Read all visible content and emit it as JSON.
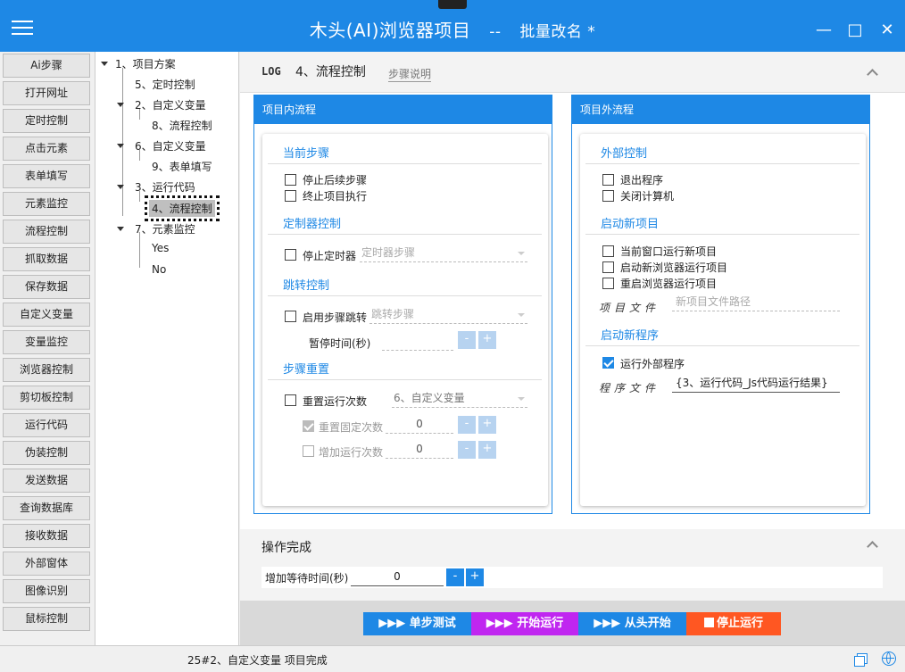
{
  "titlebar": {
    "title": "木头(AI)浏览器项目",
    "separator": "--",
    "subtitle": "批量改名 *",
    "minimize": "—",
    "maximize": "□",
    "close": "✕"
  },
  "sidebar": {
    "items": [
      "Ai步骤",
      "打开网址",
      "定时控制",
      "点击元素",
      "表单填写",
      "元素监控",
      "流程控制",
      "抓取数据",
      "保存数据",
      "自定义变量",
      "变量监控",
      "浏览器控制",
      "剪切板控制",
      "运行代码",
      "伪装控制",
      "发送数据",
      "查询数据库",
      "接收数据",
      "外部窗体",
      "图像识别",
      "鼠标控制"
    ]
  },
  "tree": {
    "nodes": [
      {
        "label": "1、项目方案"
      },
      {
        "label": "5、定时控制"
      },
      {
        "label": "2、自定义变量"
      },
      {
        "label": "8、流程控制"
      },
      {
        "label": "6、自定义变量"
      },
      {
        "label": "9、表单填写"
      },
      {
        "label": "3、运行代码"
      },
      {
        "label": "4、流程控制"
      },
      {
        "label": "7、元素监控"
      },
      {
        "label": "Yes"
      },
      {
        "label": "No"
      }
    ]
  },
  "step": {
    "icon_text": "LOG",
    "title": "4、流程控制",
    "desc_link": "步骤说明"
  },
  "inner_panel": {
    "title": "项目内流程",
    "current_step": "当前步骤",
    "stop_subsequent": "停止后续步骤",
    "terminate_project": "终止项目执行",
    "timer_control": "定制器控制",
    "stop_timer": "停止定时器",
    "timer_step_placeholder": "定时器步骤",
    "jump_control": "跳转控制",
    "enable_jump": "启用步骤跳转",
    "jump_step_placeholder": "跳转步骤",
    "pause_time": "暂停时间(秒)",
    "step_reset": "步骤重置",
    "reset_count": "重置运行次数",
    "reset_target": "6、自定义变量",
    "reset_fixed": "重置固定次数",
    "reset_fixed_value": "0",
    "add_count": "增加运行次数",
    "add_count_value": "0"
  },
  "outer_panel": {
    "title": "项目外流程",
    "external_control": "外部控制",
    "exit_program": "退出程序",
    "shutdown": "关闭计算机",
    "start_new_project": "启动新项目",
    "run_in_current": "当前窗口运行新项目",
    "run_in_new_browser": "启动新浏览器运行项目",
    "restart_browser": "重启浏览器运行项目",
    "project_file_label": "项目文件",
    "project_file_placeholder": "新项目文件路径",
    "start_new_program": "启动新程序",
    "run_external": "运行外部程序",
    "program_file_label": "程序文件",
    "program_file_value": "{3、运行代码_Js代码运行结果}"
  },
  "completion": {
    "title": "操作完成",
    "wait_label": "增加等待时间(秒)",
    "wait_value": "0",
    "minus": "-",
    "plus": "+"
  },
  "actions": {
    "single_step": "▶▶▶ 单步测试",
    "start": "▶▶▶ 开始运行",
    "from_start": "▶▶▶ 从头开始",
    "stop": "停止运行"
  },
  "status": {
    "text": "25#2、自定义变量 项目完成"
  },
  "colors": {
    "accent": "#1e88e5",
    "start_button": "#c026f0",
    "stop_button": "#ff5722"
  }
}
